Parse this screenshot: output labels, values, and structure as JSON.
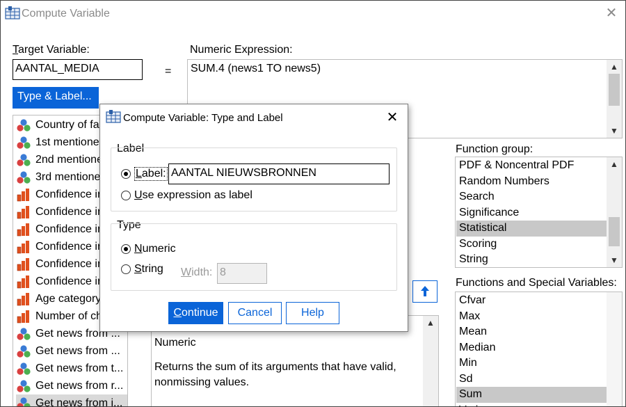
{
  "window": {
    "title": "Compute Variable",
    "close_symbol": "✕"
  },
  "target": {
    "label": "Target Variable:",
    "value": "AANTAL_MEDIA",
    "equals": "=",
    "type_label_button": "Type & Label..."
  },
  "expression": {
    "label": "Numeric Expression:",
    "value": "SUM.4 (news1 TO news5)"
  },
  "variables": [
    {
      "label": "Country of fa",
      "icon": "nominal-icon"
    },
    {
      "label": "1st mentione",
      "icon": "nominal-icon"
    },
    {
      "label": "2nd mentione",
      "icon": "nominal-icon"
    },
    {
      "label": "3rd mentione",
      "icon": "nominal-icon"
    },
    {
      "label": "Confidence ir",
      "icon": "ordinal-icon"
    },
    {
      "label": "Confidence ir",
      "icon": "ordinal-icon"
    },
    {
      "label": "Confidence ir",
      "icon": "ordinal-icon"
    },
    {
      "label": "Confidence ir",
      "icon": "ordinal-icon"
    },
    {
      "label": "Confidence ir",
      "icon": "ordinal-icon"
    },
    {
      "label": "Confidence ir",
      "icon": "ordinal-icon"
    },
    {
      "label": "Age category",
      "icon": "ordinal-icon"
    },
    {
      "label": "Number of ch",
      "icon": "ordinal-icon"
    },
    {
      "label": "Get news from ...",
      "icon": "nominal-icon"
    },
    {
      "label": "Get news from ...",
      "icon": "nominal-icon"
    },
    {
      "label": "Get news from t...",
      "icon": "nominal-icon"
    },
    {
      "label": "Get news from r...",
      "icon": "nominal-icon"
    },
    {
      "label": "Get news from i...",
      "icon": "nominal-icon",
      "selected": true
    }
  ],
  "function_group": {
    "label": "Function group:",
    "items": [
      "PDF & Noncentral PDF",
      "Random Numbers",
      "Search",
      "Significance",
      "Statistical",
      "Scoring",
      "String"
    ],
    "selected": "Statistical"
  },
  "functions": {
    "label": "Functions and Special Variables:",
    "items": [
      "Cfvar",
      "Max",
      "Mean",
      "Median",
      "Min",
      "Sd",
      "Sum",
      "Variance"
    ],
    "selected": "Sum"
  },
  "description": {
    "line1": "Numeric",
    "line2": "Returns the sum of its arguments that have valid,",
    "line3": "nonmissing values."
  },
  "dialog": {
    "title": "Compute Variable: Type and Label",
    "label_group": "Label",
    "label_option": "Label:",
    "label_value": "AANTAL NIEUWSBRONNEN",
    "use_expression": "Use expression as label",
    "type_group": "Type",
    "numeric": "Numeric",
    "string": "String",
    "width_label": "Width:",
    "width_value": "8",
    "continue": "Continue",
    "cancel": "Cancel",
    "help": "Help"
  },
  "colors": {
    "accent": "#0a64d8",
    "selection": "#c8c8c8"
  }
}
